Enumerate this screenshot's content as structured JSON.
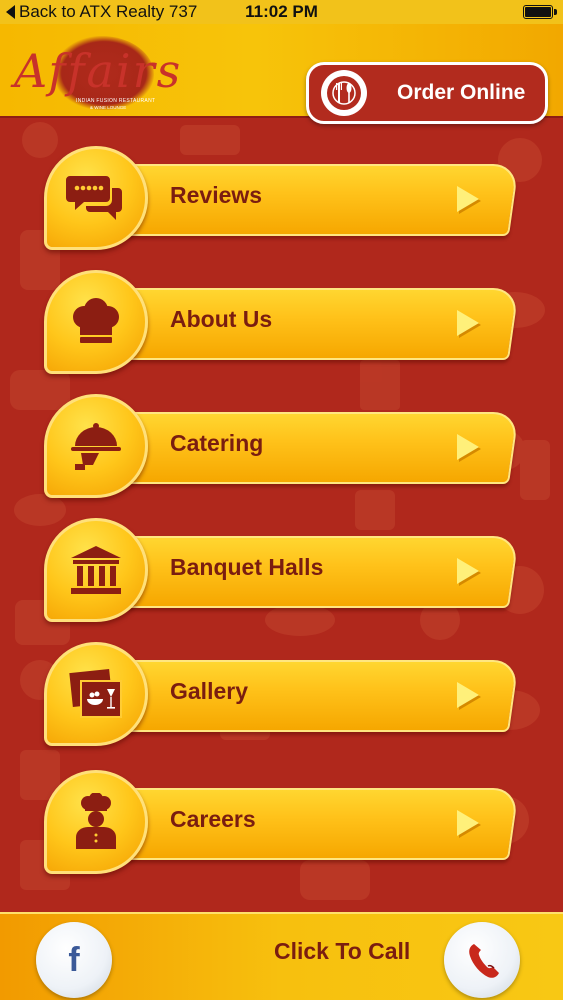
{
  "status_bar": {
    "back_label": "Back to ATX Realty 737",
    "time": "11:02 PM"
  },
  "header": {
    "logo_script": "Affairs",
    "logo_tagline": "INDIAN FUSION RESTAURANT",
    "logo_tagline2": "& WINE LOUNGE",
    "order_online_label": "Order Online"
  },
  "menu": {
    "items": [
      {
        "label": "Reviews",
        "icon": "speech-bubbles-stars-icon"
      },
      {
        "label": "About Us",
        "icon": "chef-hat-icon"
      },
      {
        "label": "Catering",
        "icon": "serving-cloche-icon"
      },
      {
        "label": "Banquet Halls",
        "icon": "building-columns-icon"
      },
      {
        "label": "Gallery",
        "icon": "photo-food-icon"
      },
      {
        "label": "Careers",
        "icon": "chef-person-icon"
      }
    ]
  },
  "footer": {
    "facebook_glyph": "f",
    "call_label": "Click To Call"
  },
  "colors": {
    "background_red": "#b0281c",
    "accent_yellow": "#ffc61a",
    "label_brown": "#7a1d10"
  }
}
